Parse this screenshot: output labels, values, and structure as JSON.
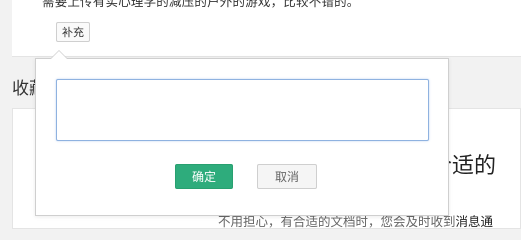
{
  "top_card": {
    "description": "需要上传有实心理学的减压的户外的游戏，比较不错的。",
    "supplement_label": "补充"
  },
  "section": {
    "title": "收藏"
  },
  "bottom_card": {
    "handwriting": "合适的",
    "notice_prefix": "不用担心，有合适的文档时，您会及时收到",
    "notice_link": "消息通"
  },
  "popover": {
    "input_value": "",
    "confirm_label": "确定",
    "cancel_label": "取消"
  },
  "colors": {
    "confirm_bg": "#2eac7c",
    "input_focus_border": "#8fb2e0"
  }
}
